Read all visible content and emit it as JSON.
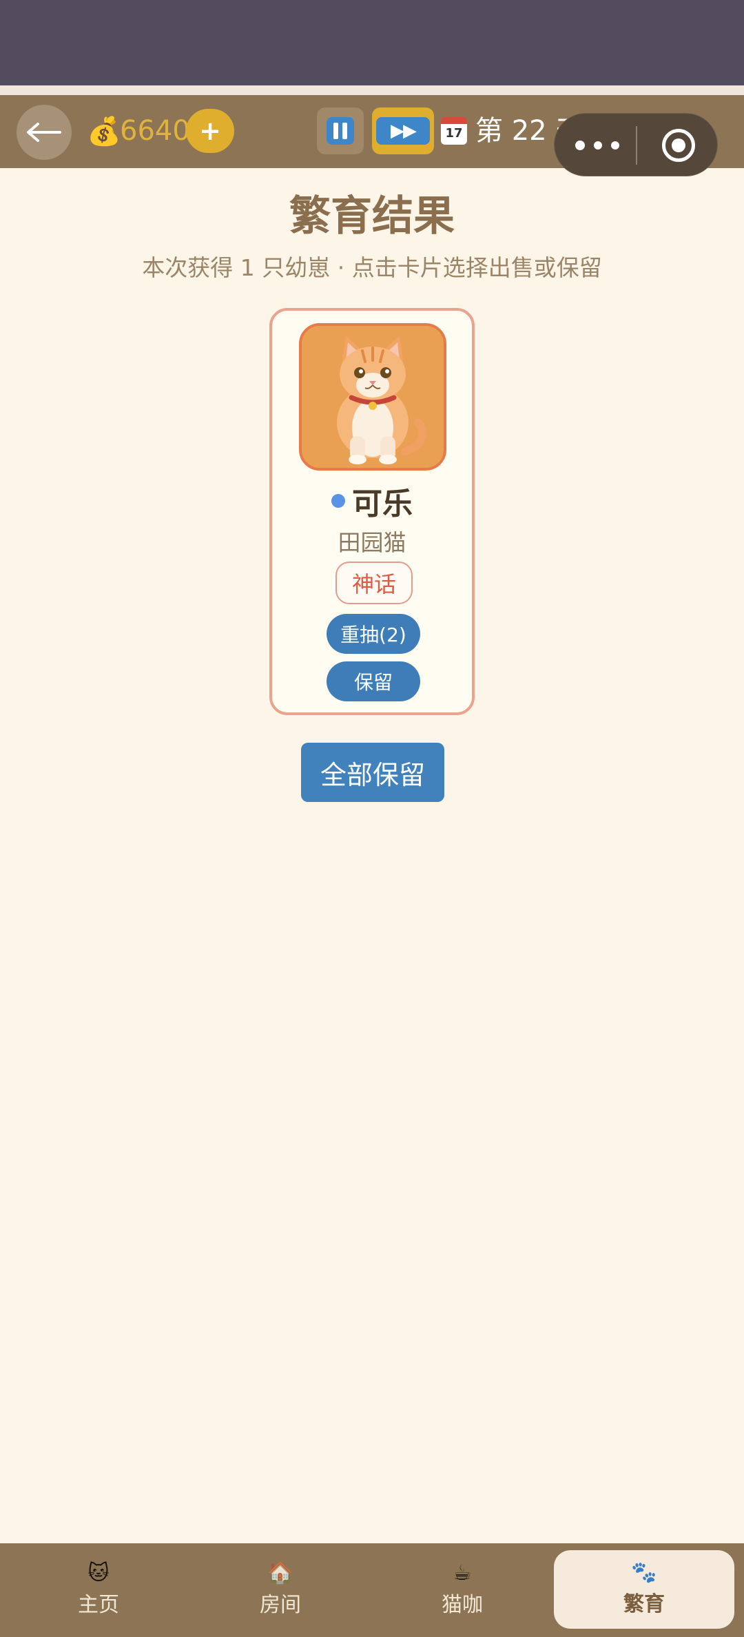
{
  "header": {
    "coins": "6640",
    "plus": "+",
    "speed": "▶▶",
    "calendar_month": "17",
    "day_text": "第 22 天"
  },
  "main": {
    "title": "繁育结果",
    "subtitle": "本次获得 1 只幼崽 · 点击卡片选择出售或保留",
    "card": {
      "name": "可乐",
      "breed": "田园猫",
      "rarity": "神话",
      "reroll": "重抽(2)",
      "keep": "保留"
    },
    "keep_all": "全部保留"
  },
  "tabs": [
    {
      "label": "主页",
      "icon": "house-cat-icon"
    },
    {
      "label": "房间",
      "icon": "room-icon"
    },
    {
      "label": "猫咖",
      "icon": "coffee-icon"
    },
    {
      "label": "繁育",
      "icon": "breeding-icon",
      "active": true
    }
  ],
  "colors": {
    "topbar": "#8c7455",
    "primary_blue": "#3f7db8",
    "rarity_red": "#dd5b45",
    "gold": "#e0ae2f"
  }
}
